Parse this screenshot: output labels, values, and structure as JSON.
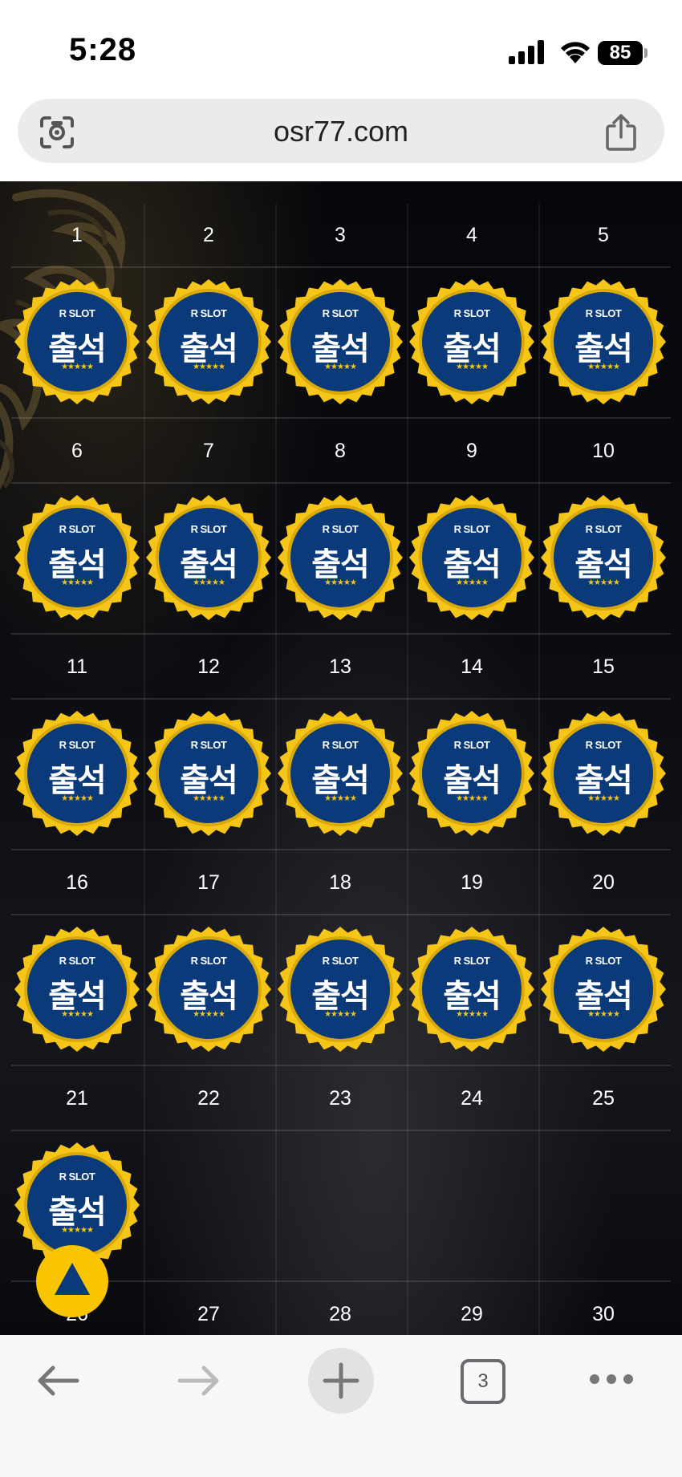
{
  "status_bar": {
    "time": "5:28",
    "battery": "85"
  },
  "browser": {
    "url": "osr77.com",
    "tab_count": "3"
  },
  "calendar": {
    "badge": {
      "brand": "R SLOT",
      "word": "출석",
      "stars": "★★★★★"
    },
    "days": [
      "1",
      "2",
      "3",
      "4",
      "5",
      "6",
      "7",
      "8",
      "9",
      "10",
      "11",
      "12",
      "13",
      "14",
      "15",
      "16",
      "17",
      "18",
      "19",
      "20",
      "21",
      "22",
      "23",
      "24",
      "25",
      "26",
      "27",
      "28",
      "29",
      "30"
    ],
    "checked_days": 21
  },
  "colors": {
    "badge_blue": "#0b3a7a",
    "badge_gold": "#f5c518",
    "scroll_top_button": "#f9c400"
  },
  "icons": {
    "lens": "lens-icon",
    "share": "share-icon",
    "back": "back-arrow-icon",
    "forward": "forward-arrow-icon",
    "new_tab": "plus-icon",
    "tabs": "tabs-icon",
    "more": "more-icon",
    "scroll_top": "up-triangle-icon"
  }
}
